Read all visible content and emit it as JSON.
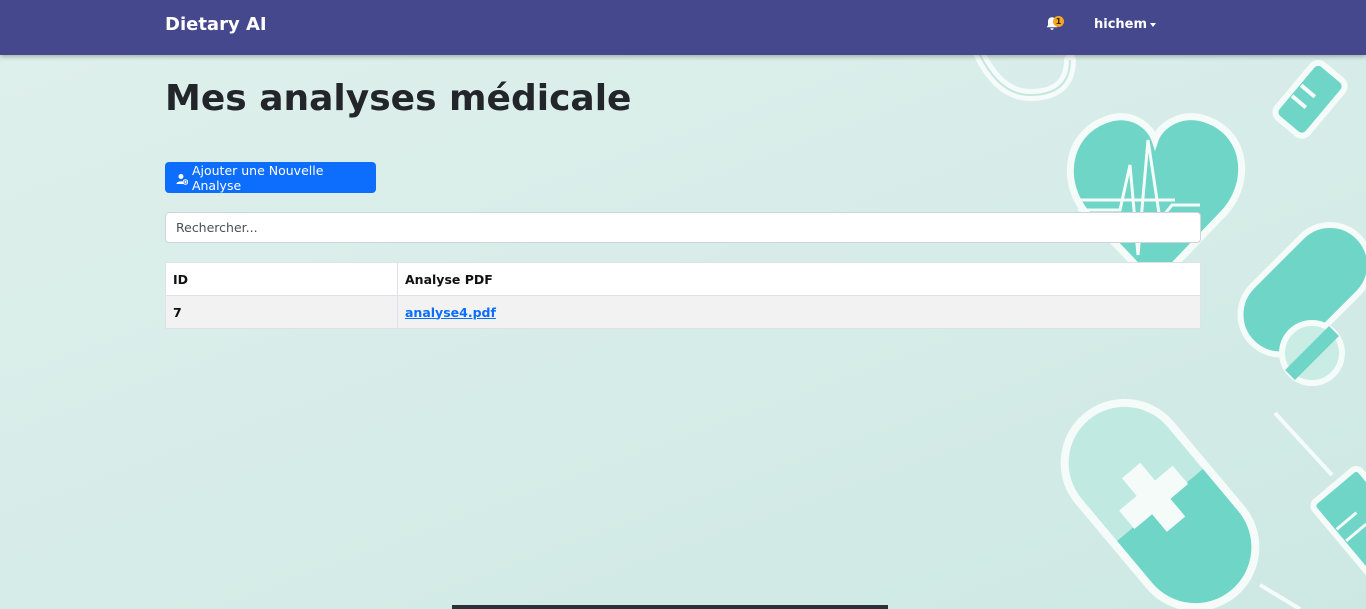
{
  "navbar": {
    "brand": "Dietary AI",
    "notification_count": "1",
    "user_name": "hichem"
  },
  "main": {
    "title": "Mes analyses médicale",
    "add_button_label": "Ajouter une Nouvelle Analyse",
    "search_placeholder": "Rechercher..."
  },
  "table": {
    "headers": [
      "ID",
      "Analyse PDF"
    ],
    "rows": [
      {
        "id": "7",
        "pdf": "analyse4.pdf"
      }
    ]
  },
  "colors": {
    "navbar": "#45488c",
    "primary": "#0d6efd",
    "badge": "#f5a623",
    "teal": "#6fd5c6"
  },
  "icons": {
    "notification": "bell-icon",
    "add": "user-plus-icon",
    "dropdown": "chevron-down-icon"
  }
}
